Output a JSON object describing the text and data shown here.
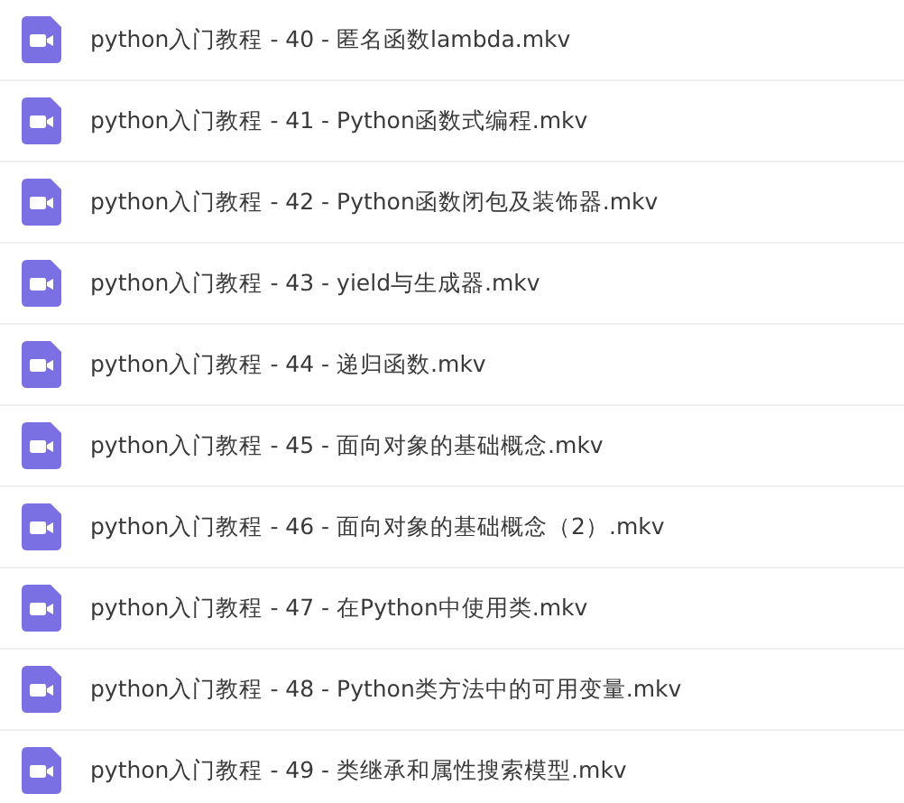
{
  "files": [
    {
      "name": "python入门教程 - 40 - 匿名函数lambda.mkv"
    },
    {
      "name": "python入门教程 - 41 - Python函数式编程.mkv"
    },
    {
      "name": "python入门教程 - 42 - Python函数闭包及装饰器.mkv"
    },
    {
      "name": "python入门教程 - 43 - yield与生成器.mkv"
    },
    {
      "name": "python入门教程 - 44 - 递归函数.mkv"
    },
    {
      "name": "python入门教程 - 45 - 面向对象的基础概念.mkv"
    },
    {
      "name": "python入门教程 - 46 - 面向对象的基础概念（2）.mkv"
    },
    {
      "name": "python入门教程 - 47 - 在Python中使用类.mkv"
    },
    {
      "name": "python入门教程 - 48 - Python类方法中的可用变量.mkv"
    },
    {
      "name": "python入门教程 - 49 - 类继承和属性搜索模型.mkv"
    }
  ]
}
